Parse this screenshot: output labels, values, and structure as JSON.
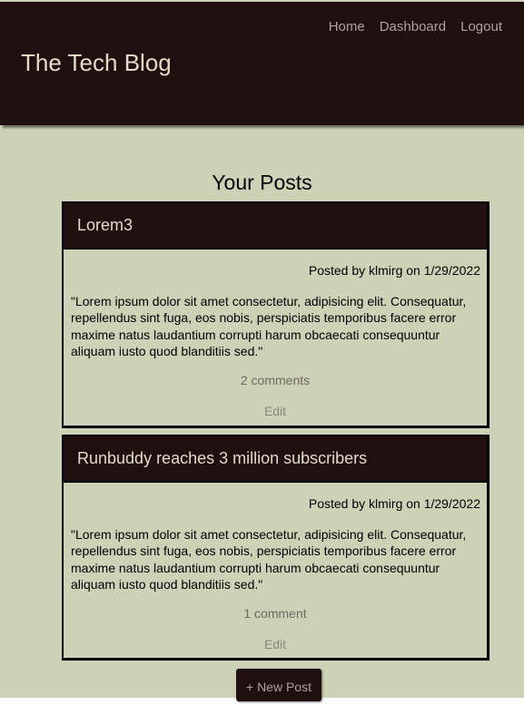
{
  "site": {
    "title": "The Tech Blog"
  },
  "nav": {
    "items": [
      {
        "label": "Home"
      },
      {
        "label": "Dashboard"
      },
      {
        "label": "Logout"
      }
    ]
  },
  "main": {
    "section_title": "Your Posts",
    "posts": [
      {
        "title": "Lorem3",
        "meta": "Posted by klmirg on 1/29/2022",
        "body": "\"Lorem ipsum dolor sit amet consectetur, adipisicing elit. Consequatur, repellendus sint fuga, eos nobis, perspiciatis temporibus facere error maxime natus laudantium corrupti harum obcaecati consequuntur aliquam iusto quod blanditiis sed.\"",
        "comments": "2 comments",
        "edit_label": "Edit"
      },
      {
        "title": "Runbuddy reaches 3 million subscribers",
        "meta": "Posted by klmirg on 1/29/2022",
        "body": "\"Lorem ipsum dolor sit amet consectetur, adipisicing elit. Consequatur, repellendus sint fuga, eos nobis, perspiciatis temporibus facere error maxime natus laudantium corrupti harum obcaecati consequuntur aliquam iusto quod blanditiis sed.\"",
        "comments": "1 comment",
        "edit_label": "Edit"
      }
    ],
    "new_post_label": "+ New Post"
  },
  "colors": {
    "header_bg": "#1f0f0f",
    "page_bg": "#cdd1b5",
    "title_text": "#e2dcc6",
    "nav_text": "#a9a39a"
  }
}
